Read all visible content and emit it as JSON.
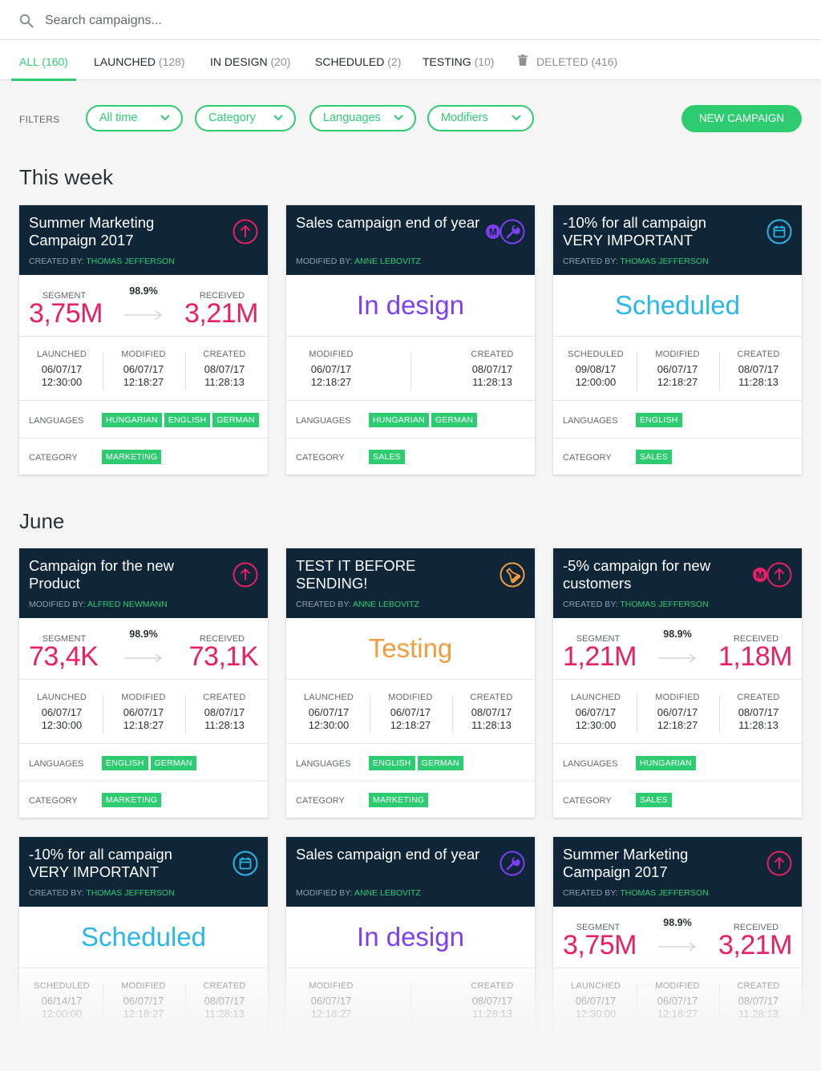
{
  "search": {
    "placeholder": "Search campaigns..."
  },
  "tabs": [
    {
      "label": "ALL",
      "count": "(160)"
    },
    {
      "label": "LAUNCHED",
      "count": "(128)"
    },
    {
      "label": "IN DESIGN",
      "count": "(20)"
    },
    {
      "label": "SCHEDULED",
      "count": "(2)"
    },
    {
      "label": "TESTING",
      "count": "(10)"
    },
    {
      "label": "DELETED",
      "count": "(416)"
    }
  ],
  "filters": {
    "label": "FILTERS",
    "items": [
      "All time",
      "Category",
      "Languages",
      "Modifiers"
    ],
    "new_campaign": "NEW CAMPAIGN"
  },
  "colors": {
    "accent": "#2ecc71",
    "header": "#0f2538",
    "launched": "#e91e63",
    "design": "#7e3ff2",
    "scheduled": "#29b6e8",
    "testing": "#f39c3d"
  },
  "sections": [
    {
      "title": "This week",
      "cards": [
        {
          "title": "Summer Marketing Campaign 2017",
          "meta_label": "CREATED BY:",
          "meta_name": "THOMAS JEFFERSON",
          "icon": "arrow-up-icon",
          "kind": "launched",
          "segment_label": "SEGMENT",
          "segment": "3,75M",
          "pct": "98.9%",
          "received_label": "RECEIVED",
          "received": "3,21M",
          "dates": [
            {
              "label": "LAUNCHED",
              "date": "06/07/17",
              "time": "12:30:00"
            },
            {
              "label": "MODIFIED",
              "date": "06/07/17",
              "time": "12:18:27"
            },
            {
              "label": "CREATED",
              "date": "08/07/17",
              "time": "11:28:13"
            }
          ],
          "languages_label": "LANGUAGES",
          "languages": [
            "HUNGARIAN",
            "ENGLISH",
            "GERMAN"
          ],
          "category_label": "CATEGORY",
          "category": "MARKETING"
        },
        {
          "title": "Sales campaign end of year",
          "meta_label": "MODIFIED BY:",
          "meta_name": "ANNE LEBOVITZ",
          "icon": "wrench-icon",
          "badge": "M",
          "kind": "design",
          "status": "In design",
          "dates": [
            {
              "label": "MODIFIED",
              "date": "06/07/17",
              "time": "12:18:27"
            },
            {
              "label": "CREATED",
              "date": "08/07/17",
              "time": "11:28:13"
            }
          ],
          "languages_label": "LANGUAGES",
          "languages": [
            "HUNGARIAN",
            "GERMAN"
          ],
          "category_label": "CATEGORY",
          "category": "SALES"
        },
        {
          "title": "-10% for all campaign VERY IMPORTANT",
          "meta_label": "CREATED BY:",
          "meta_name": "THOMAS JEFFERSON",
          "icon": "calendar-icon",
          "kind": "scheduled",
          "status": "Scheduled",
          "dates": [
            {
              "label": "SCHEDULED",
              "date": "09/08/17",
              "time": "12:00:00"
            },
            {
              "label": "MODIFIED",
              "date": "06/07/17",
              "time": "12:18:27"
            },
            {
              "label": "CREATED",
              "date": "08/07/17",
              "time": "11:28:13"
            }
          ],
          "languages_label": "LANGUAGES",
          "languages": [
            "ENGLISH"
          ],
          "category_label": "CATEGORY",
          "category": "SALES"
        }
      ]
    },
    {
      "title": "June",
      "cards": [
        {
          "title": "Campaign for the new Product",
          "meta_label": "MODIFIED BY:",
          "meta_name": "ALFRED NEWMANN",
          "icon": "arrow-up-icon",
          "kind": "launched",
          "segment_label": "SEGMENT",
          "segment": "73,4K",
          "pct": "98.9%",
          "received_label": "RECEIVED",
          "received": "73,1K",
          "dates": [
            {
              "label": "LAUNCHED",
              "date": "06/07/17",
              "time": "12:30:00"
            },
            {
              "label": "MODIFIED",
              "date": "06/07/17",
              "time": "12:18:27"
            },
            {
              "label": "CREATED",
              "date": "08/07/17",
              "time": "11:28:13"
            }
          ],
          "languages_label": "LANGUAGES",
          "languages": [
            "ENGLISH",
            "GERMAN"
          ],
          "category_label": "CATEGORY",
          "category": "MARKETING"
        },
        {
          "title": "TEST IT BEFORE SENDING!",
          "meta_label": "CREATED BY:",
          "meta_name": "ANNE LEBOVITZ",
          "icon": "flask-icon",
          "kind": "testing",
          "status": "Testing",
          "dates": [
            {
              "label": "LAUNCHED",
              "date": "06/07/17",
              "time": "12:30:00"
            },
            {
              "label": "MODIFIED",
              "date": "06/07/17",
              "time": "12:18:27"
            },
            {
              "label": "CREATED",
              "date": "08/07/17",
              "time": "11:28:13"
            }
          ],
          "languages_label": "LANGUAGES",
          "languages": [
            "ENGLISH",
            "GERMAN"
          ],
          "category_label": "CATEGORY",
          "category": "MARKETING"
        },
        {
          "title": "-5% campaign for new customers",
          "meta_label": "CREATED BY:",
          "meta_name": "THOMAS JEFFERSON",
          "icon": "arrow-up-icon",
          "badge": "M",
          "kind": "launched",
          "segment_label": "SEGMENT",
          "segment": "1,21M",
          "pct": "98.9%",
          "received_label": "RECEIVED",
          "received": "1,18M",
          "dates": [
            {
              "label": "LAUNCHED",
              "date": "06/07/17",
              "time": "12:30:00"
            },
            {
              "label": "MODIFIED",
              "date": "06/07/17",
              "time": "12:18:27"
            },
            {
              "label": "CREATED",
              "date": "08/07/17",
              "time": "11:28:13"
            }
          ],
          "languages_label": "LANGUAGES",
          "languages": [
            "HUNGARIAN"
          ],
          "category_label": "CATEGORY",
          "category": "SALES"
        },
        {
          "title": "-10% for all campaign VERY IMPORTANT",
          "meta_label": "CREATED BY:",
          "meta_name": "THOMAS JEFFERSON",
          "icon": "calendar-icon",
          "kind": "scheduled",
          "status": "Scheduled",
          "dates": [
            {
              "label": "SCHEDULED",
              "date": "06/14/17",
              "time": "12:00:00"
            },
            {
              "label": "MODIFIED",
              "date": "06/07/17",
              "time": "12:18:27"
            },
            {
              "label": "CREATED",
              "date": "08/07/17",
              "time": "11:28:13"
            }
          ]
        },
        {
          "title": "Sales campaign end of year",
          "meta_label": "MODIFIED BY:",
          "meta_name": "ANNE LEBOVITZ",
          "icon": "wrench-icon",
          "kind": "design",
          "status": "In design",
          "dates": [
            {
              "label": "MODIFIED",
              "date": "06/07/17",
              "time": "12:18:27"
            },
            {
              "label": "CREATED",
              "date": "08/07/17",
              "time": "11:28:13"
            }
          ]
        },
        {
          "title": "Summer Marketing Campaign 2017",
          "meta_label": "CREATED BY:",
          "meta_name": "THOMAS JEFFERSON",
          "icon": "arrow-up-icon",
          "kind": "launched",
          "segment_label": "SEGMENT",
          "segment": "3,75M",
          "pct": "98.9%",
          "received_label": "RECEIVED",
          "received": "3,21M",
          "dates": [
            {
              "label": "LAUNCHED",
              "date": "06/07/17",
              "time": "12:30:00"
            },
            {
              "label": "MODIFIED",
              "date": "06/07/17",
              "time": "12:18:27"
            },
            {
              "label": "CREATED",
              "date": "08/07/17",
              "time": "11:28:13"
            }
          ]
        }
      ]
    }
  ]
}
